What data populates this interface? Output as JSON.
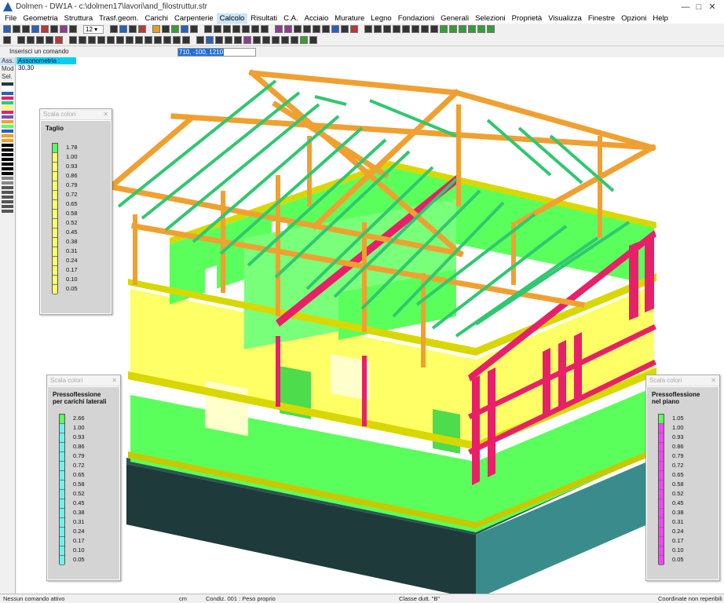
{
  "window": {
    "title": "Dolmen - DW1A - c:\\dolmen17\\lavori\\and_filostruttur.str",
    "minimize": "—",
    "maximize": "□",
    "close": "✕"
  },
  "menu": [
    "File",
    "Geometria",
    "Struttura",
    "Trasf.geom.",
    "Carichi",
    "Carpenterie",
    "Calcolo",
    "Risultati",
    "C.A.",
    "Acciaio",
    "Murature",
    "Legno",
    "Fondazioni",
    "Generali",
    "Selezioni",
    "Proprietà",
    "Visualizza",
    "Finestre",
    "Opzioni",
    "Help"
  ],
  "menu_active": "Calcolo",
  "toolbar": {
    "zoom_value": "12 ▾"
  },
  "command": {
    "label": "Inserisci un comando",
    "coord_value": "710, -100, 1210"
  },
  "left_panel": {
    "tabs": [
      "Ass.",
      "Mod",
      "Sel."
    ]
  },
  "viewport": {
    "view_label": "Assonometria : 30,30"
  },
  "legends": [
    {
      "header": "Scala colori",
      "title_lines": [
        "Taglio"
      ],
      "ticks": [
        "1.78",
        "1.00",
        "0.93",
        "0.86",
        "0.79",
        "0.72",
        "0.65",
        "0.58",
        "0.52",
        "0.45",
        "0.38",
        "0.31",
        "0.24",
        "0.17",
        "0.10",
        "0.05"
      ],
      "top_color": "#5bff5b",
      "fill_color": "#ffff66"
    },
    {
      "header": "Scala colori",
      "title_lines": [
        "Pressoflessione",
        "per carichi laterali"
      ],
      "ticks": [
        "2.66",
        "1.00",
        "0.93",
        "0.86",
        "0.79",
        "0.72",
        "0.65",
        "0.58",
        "0.52",
        "0.45",
        "0.38",
        "0.31",
        "0.24",
        "0.17",
        "0.10",
        "0.05"
      ],
      "top_color": "#5bff5b",
      "fill_color": "#70f0f0"
    },
    {
      "header": "Scala colori",
      "title_lines": [
        "Pressoflessione",
        "nel piano"
      ],
      "ticks": [
        "1.05",
        "1.00",
        "0.93",
        "0.86",
        "0.79",
        "0.72",
        "0.65",
        "0.58",
        "0.52",
        "0.45",
        "0.38",
        "0.31",
        "0.24",
        "0.17",
        "0.10",
        "0.05"
      ],
      "top_color": "#5bff5b",
      "fill_color": "#ff40ff"
    }
  ],
  "status": {
    "message": "Nessun comando attivo",
    "units": "cm",
    "condition": "Condiz. 001 : Peso proprio",
    "class": "Classe dutt. \"B\"",
    "coordinates": "Coordinate non reperibili"
  },
  "colors": {
    "wall_green": "#5bff5b",
    "wall_yellow": "#ffff66",
    "beam_yellow": "#e6e600",
    "timber_orange": "#f0a030",
    "purlin_green": "#2ec870",
    "column_magenta": "#e8206a",
    "foundation_dark": "#1f3a3a",
    "foundation_teal": "#3a8c8c"
  }
}
